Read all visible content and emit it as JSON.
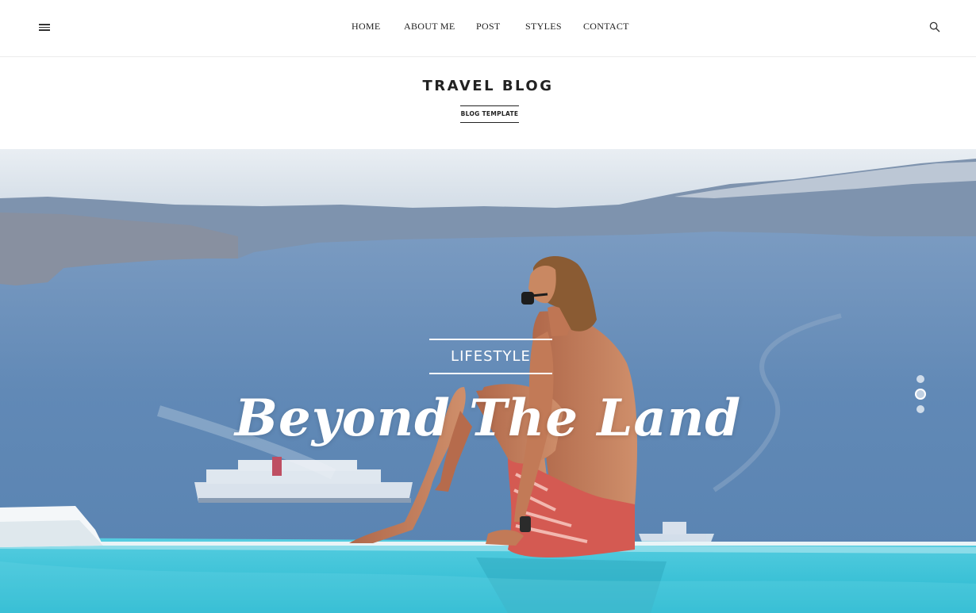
{
  "nav": {
    "items": [
      {
        "label": "HOME"
      },
      {
        "label": "ABOUT ME"
      },
      {
        "label": "POST"
      },
      {
        "label": "STYLES"
      },
      {
        "label": "CONTACT"
      }
    ],
    "menu_icon": "hamburger-icon",
    "search_icon": "search-icon"
  },
  "brand": {
    "title": "TRAVEL BLOG",
    "subtitle": "BLOG TEMPLATE"
  },
  "hero": {
    "category": "LIFESTYLE",
    "title": "Beyond The Land",
    "slider": {
      "count": 3,
      "active_index": 1
    }
  },
  "colors": {
    "text": "#222222",
    "sky": "#dde6ee",
    "sea": "#5f86b4",
    "pool": "#39c3d6",
    "white": "#ffffff"
  }
}
